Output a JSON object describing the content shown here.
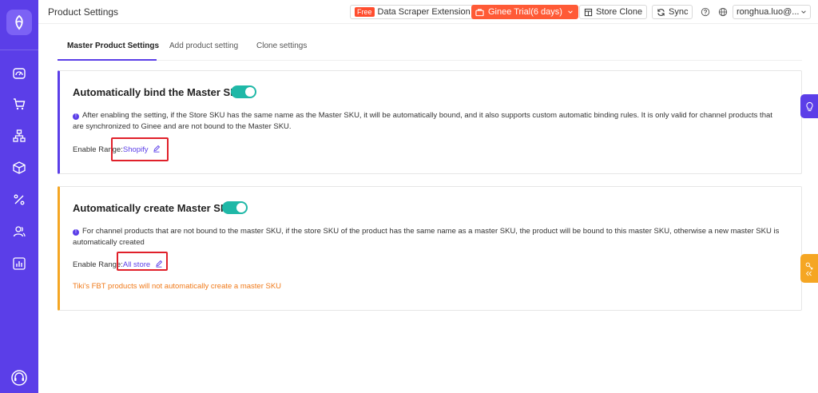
{
  "header": {
    "title": "Product Settings",
    "free_badge": "Free",
    "data_scraper": "Data Scraper Extension",
    "trial": "Ginee Trial(6 days)",
    "store_clone": "Store Clone",
    "sync": "Sync",
    "user": "ronghua.luo@..."
  },
  "tabs": [
    {
      "label": "Master Product Settings"
    },
    {
      "label": "Add product setting"
    },
    {
      "label": "Clone settings"
    }
  ],
  "card1": {
    "title": "Automatically bind the Master SKU",
    "description": "After enabling the setting, if the Store SKU has the same name as the Master SKU, it will be automatically bound, and it also supports custom automatic binding rules. It is only valid for channel products that are synchronized to Ginee and are not bound to the Master SKU.",
    "range_label": "Enable Range:",
    "range_value": "Shopify"
  },
  "card2": {
    "title": "Automatically create Master SKU",
    "description": "For channel products that are not bound to the master SKU, if the store SKU of the product has the same name as a master SKU, the product will be bound to this master SKU, otherwise a new master SKU is automatically created",
    "range_label": "Enable Range:",
    "range_value": "All store",
    "warning": "Tiki's FBT products will not automatically create a master SKU"
  },
  "colors": {
    "brand": "#5b3ee8",
    "toggle_on": "#1fb8a7",
    "warning": "#f07a1a",
    "trial": "#ff5a36"
  }
}
